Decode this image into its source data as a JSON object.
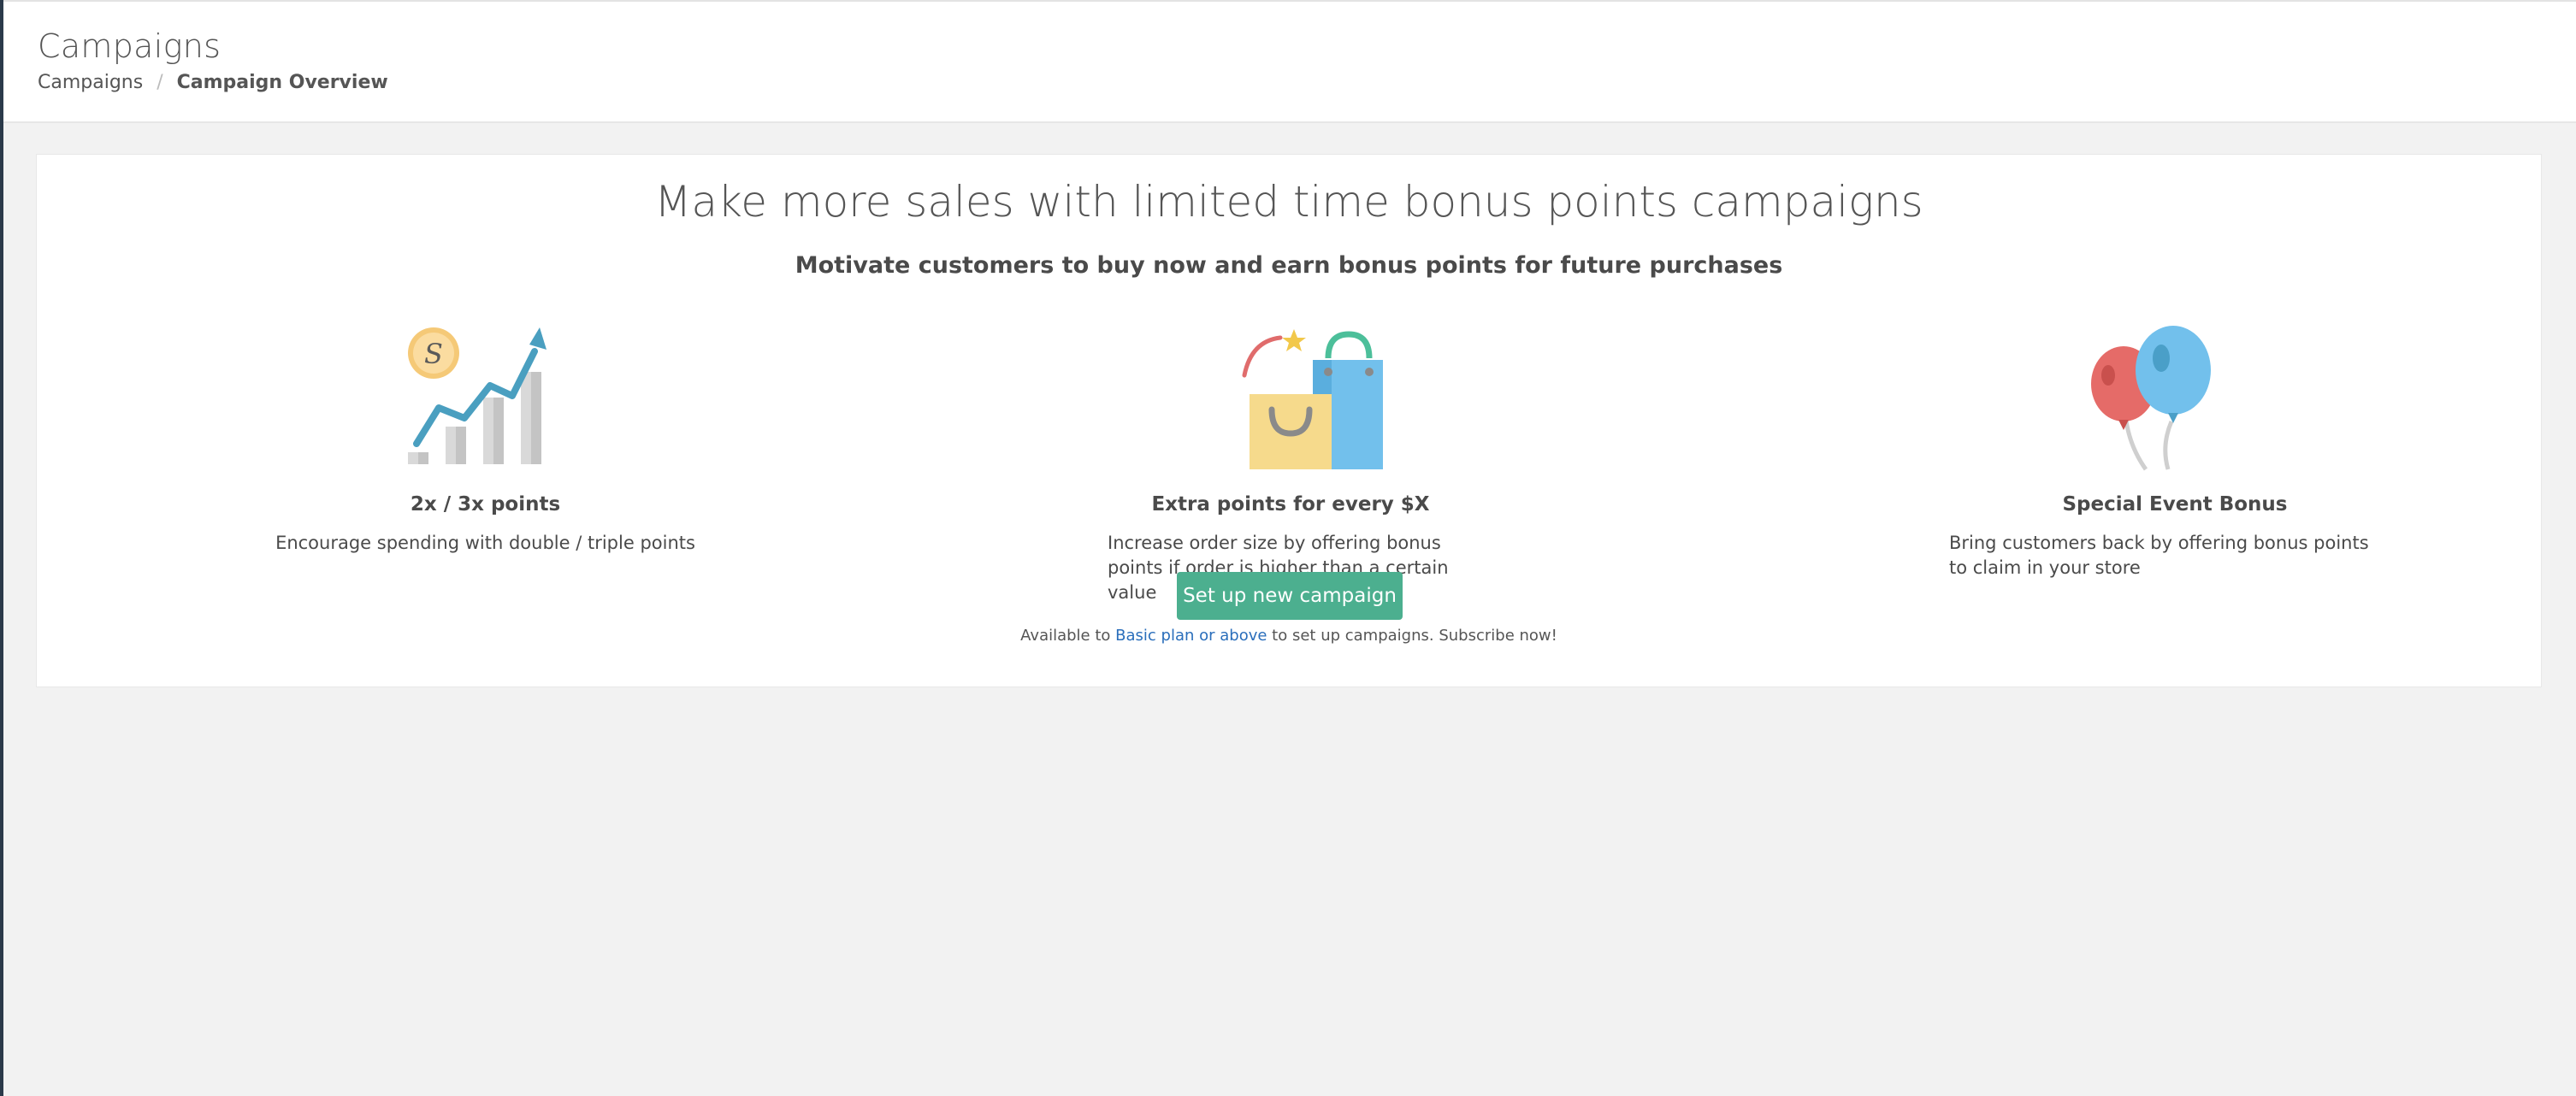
{
  "header": {
    "title": "Campaigns",
    "breadcrumb": {
      "link": "Campaigns",
      "separator": "/",
      "current": "Campaign Overview"
    }
  },
  "hero": {
    "headline": "Make more sales with limited time bonus points campaigns",
    "subheadline": "Motivate customers to buy now and earn bonus points for future purchases"
  },
  "features": [
    {
      "icon": "growth-chart-icon",
      "title": "2x / 3x points",
      "description": "Encourage spending with double / triple points"
    },
    {
      "icon": "shopping-bags-icon",
      "title": "Extra points for every $X",
      "description": "Increase order size by offering bonus points if order is higher than a certain value"
    },
    {
      "icon": "balloons-icon",
      "title": "Special Event Bonus",
      "description": "Bring customers back by offering bonus points to claim in your store"
    }
  ],
  "cta": {
    "button_label": "Set up new campaign",
    "note_prefix": "Available to ",
    "note_link": "Basic plan or above",
    "note_suffix": " to set up campaigns. Subscribe now!"
  },
  "colors": {
    "accent_green": "#4caf8f",
    "link_blue": "#2a6ebb",
    "page_bg": "#f2f2f2"
  }
}
